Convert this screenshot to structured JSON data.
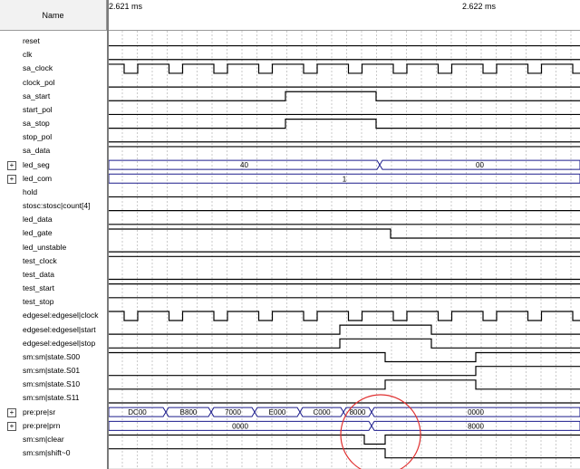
{
  "header": {
    "name_column": "Name",
    "time_start": "2.621 ms",
    "time_mid": "2.622 ms"
  },
  "signals": [
    {
      "name": "reset",
      "type": "bit"
    },
    {
      "name": "clk",
      "type": "bit"
    },
    {
      "name": "sa_clock",
      "type": "bit"
    },
    {
      "name": "clock_pol",
      "type": "bit"
    },
    {
      "name": "sa_start",
      "type": "bit"
    },
    {
      "name": "start_pol",
      "type": "bit"
    },
    {
      "name": "sa_stop",
      "type": "bit"
    },
    {
      "name": "stop_pol",
      "type": "bit"
    },
    {
      "name": "sa_data",
      "type": "bit"
    },
    {
      "name": "led_seg",
      "type": "bus",
      "expandable": true,
      "values": [
        "40",
        "00"
      ]
    },
    {
      "name": "led_com",
      "type": "bus",
      "expandable": true,
      "values": [
        "1"
      ]
    },
    {
      "name": "hold",
      "type": "bit"
    },
    {
      "name": "stosc:stosc|count[4]",
      "type": "bit"
    },
    {
      "name": "led_data",
      "type": "bit"
    },
    {
      "name": "led_gate",
      "type": "bit"
    },
    {
      "name": "led_unstable",
      "type": "bit"
    },
    {
      "name": "test_clock",
      "type": "bit"
    },
    {
      "name": "test_data",
      "type": "bit"
    },
    {
      "name": "test_start",
      "type": "bit"
    },
    {
      "name": "test_stop",
      "type": "bit"
    },
    {
      "name": "edgesel:edgesel|clock",
      "type": "bit"
    },
    {
      "name": "edgesel:edgesel|start",
      "type": "bit"
    },
    {
      "name": "edgesel:edgesel|stop",
      "type": "bit"
    },
    {
      "name": "sm:sm|state.S00",
      "type": "bit"
    },
    {
      "name": "sm:sm|state.S01",
      "type": "bit"
    },
    {
      "name": "sm:sm|state.S10",
      "type": "bit"
    },
    {
      "name": "sm:sm|state.S11",
      "type": "bit"
    },
    {
      "name": "pre:pre|sr",
      "type": "bus",
      "expandable": true,
      "values": [
        "DC00",
        "B800",
        "7000",
        "E000",
        "C000",
        "8000",
        "0000"
      ]
    },
    {
      "name": "pre:pre|prn",
      "type": "bus",
      "expandable": true,
      "values": [
        "0000",
        "8000"
      ]
    },
    {
      "name": "sm:sm|clear",
      "type": "bit"
    },
    {
      "name": "sm:sm|shift~0",
      "type": "bit"
    }
  ],
  "colors": {
    "wave": "#000000",
    "bus": "#1c1c8c",
    "grid": "#a8a8a8",
    "annotation": "#e03030"
  },
  "icons": {
    "expander": "plus-box-icon"
  },
  "expander_glyph": "+"
}
